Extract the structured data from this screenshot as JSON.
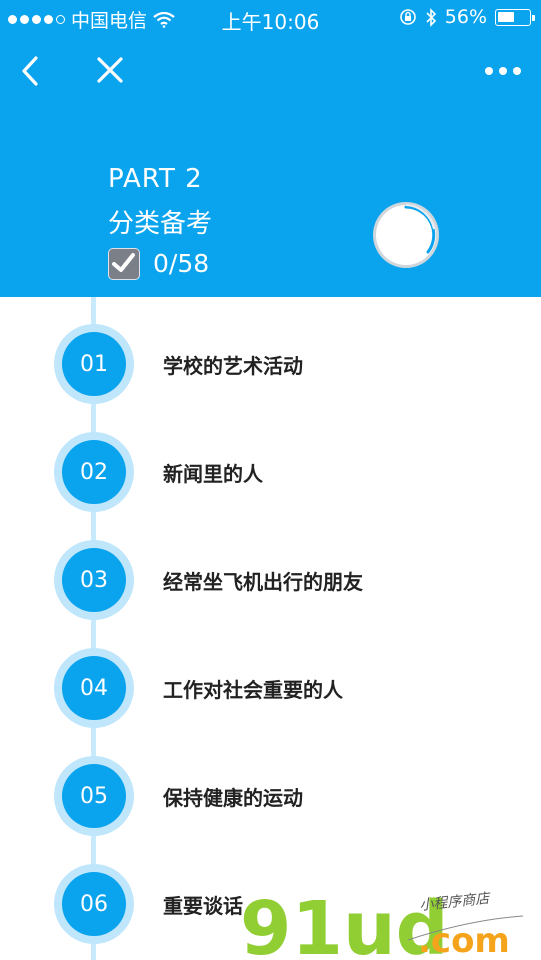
{
  "status_bar": {
    "carrier": "中国电信",
    "time": "上午10:06",
    "battery_percent": "56%",
    "battery_level": 0.56
  },
  "nav": {
    "back_icon": "chevron-left-icon",
    "close_icon": "close-icon",
    "more_icon": "more-dots-icon"
  },
  "header": {
    "part_title": "PART 2",
    "part_subtitle": "分类备考",
    "progress_count": "0/58",
    "progress_fraction": 0.0
  },
  "items": [
    {
      "number": "01",
      "label": "学校的艺术活动"
    },
    {
      "number": "02",
      "label": "新闻里的人"
    },
    {
      "number": "03",
      "label": "经常坐飞机出行的朋友"
    },
    {
      "number": "04",
      "label": "工作对社会重要的人"
    },
    {
      "number": "05",
      "label": "保持健康的运动"
    },
    {
      "number": "06",
      "label": "重要谈话"
    }
  ],
  "watermark": {
    "brand": "91ud",
    "suffix": ".com",
    "tagline": "小程序商店"
  },
  "colors": {
    "accent": "#0aa3ee",
    "timeline": "#c9eafb",
    "circle_ring": "#bfe6fb",
    "watermark_green": "#8ccc2a",
    "watermark_orange": "#f5a31a"
  }
}
